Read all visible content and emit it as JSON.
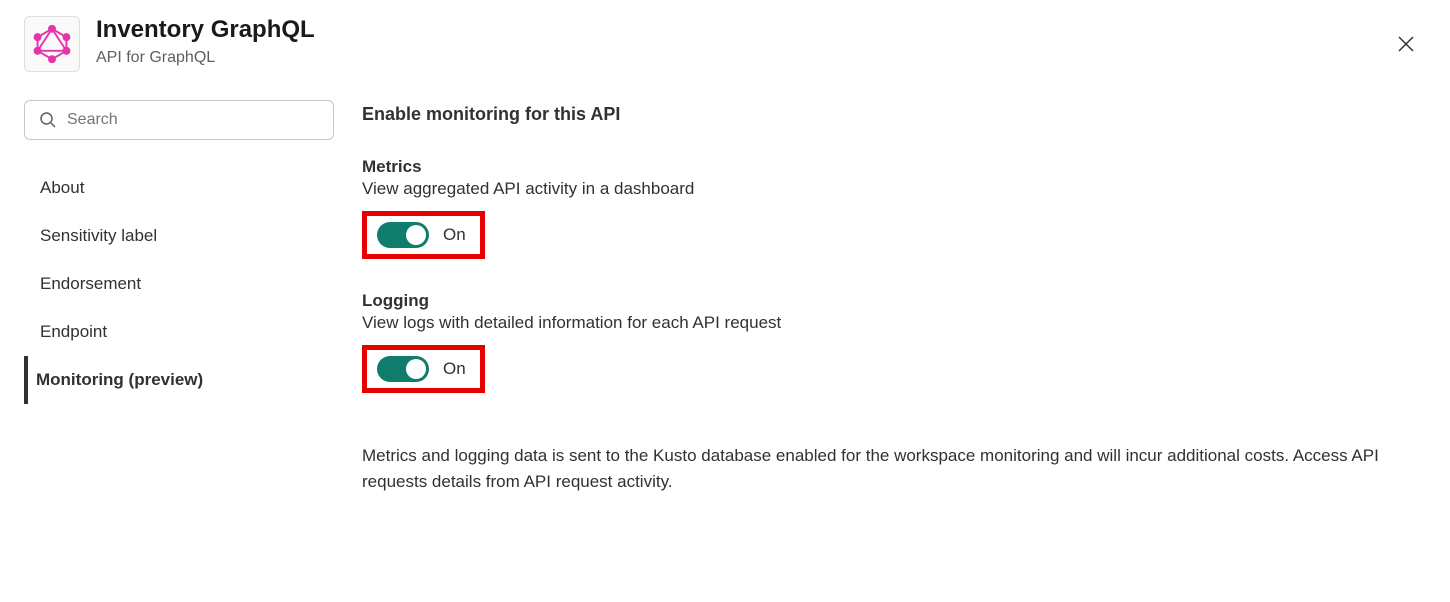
{
  "header": {
    "title": "Inventory GraphQL",
    "subtitle": "API for GraphQL"
  },
  "search": {
    "placeholder": "Search"
  },
  "sidebar": {
    "items": [
      {
        "label": "About",
        "active": false
      },
      {
        "label": "Sensitivity label",
        "active": false
      },
      {
        "label": "Endorsement",
        "active": false
      },
      {
        "label": "Endpoint",
        "active": false
      },
      {
        "label": "Monitoring (preview)",
        "active": true
      }
    ]
  },
  "main": {
    "heading": "Enable monitoring for this API",
    "metrics": {
      "title": "Metrics",
      "description": "View aggregated API activity in a dashboard",
      "toggle_state": "On"
    },
    "logging": {
      "title": "Logging",
      "description": "View logs with detailed information for each API request",
      "toggle_state": "On"
    },
    "footer": "Metrics and logging data is sent to the Kusto database enabled for the workspace monitoring and will incur additional costs. Access API requests details from API request activity."
  },
  "colors": {
    "toggle_on": "#107c6b",
    "highlight": "#e60000",
    "graphql_pink": "#e535ab"
  }
}
